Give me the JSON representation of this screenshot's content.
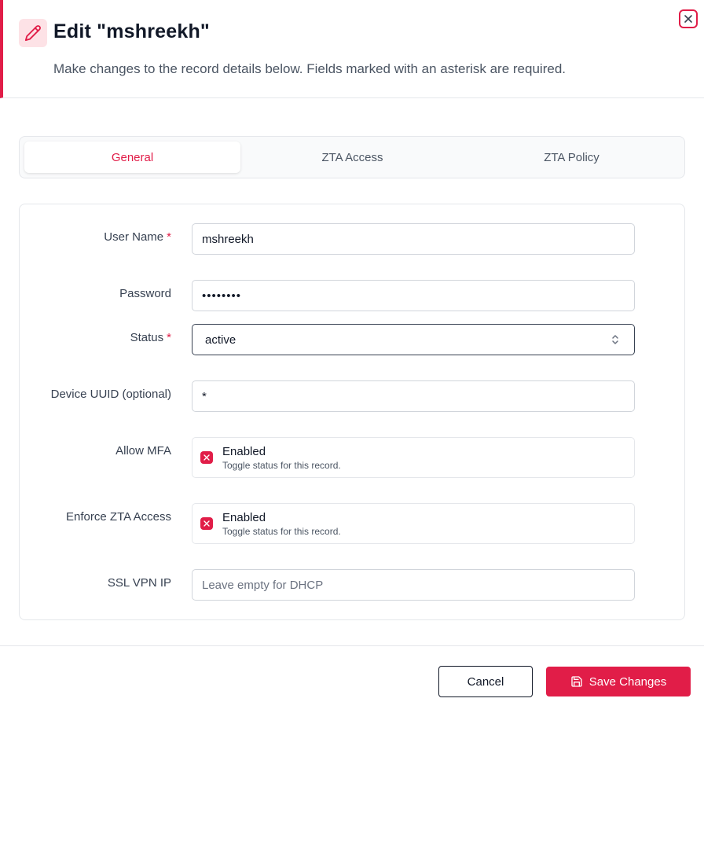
{
  "header": {
    "title": "Edit \"mshreekh\"",
    "subtitle": "Make changes to the record details below. Fields marked with an asterisk are required.",
    "icon": "pencil-icon",
    "close_icon": "close-icon"
  },
  "tabs": [
    {
      "label": "General",
      "active": true
    },
    {
      "label": "ZTA Access",
      "active": false
    },
    {
      "label": "ZTA Policy",
      "active": false
    }
  ],
  "form": {
    "required_marker": "*",
    "username": {
      "label": "User Name",
      "value": "mshreekh",
      "required": true
    },
    "password": {
      "label": "Password",
      "value": "••••••••"
    },
    "status": {
      "label": "Status",
      "value": "active",
      "required": true
    },
    "device_uuid": {
      "label": "Device UUID (optional)",
      "value": "*"
    },
    "allow_mfa": {
      "label": "Allow MFA",
      "toggle_label": "Enabled",
      "help": "Toggle status for this record."
    },
    "enforce_zta": {
      "label": "Enforce ZTA Access",
      "toggle_label": "Enabled",
      "help": "Toggle status for this record."
    },
    "ssl_vpn_ip": {
      "label": "SSL VPN IP",
      "placeholder": "Leave empty for DHCP"
    }
  },
  "footer": {
    "cancel_label": "Cancel",
    "save_label": "Save Changes"
  },
  "colors": {
    "accent": "#e11d48",
    "accent_light": "#fde2e6",
    "border": "#e5e7eb"
  }
}
